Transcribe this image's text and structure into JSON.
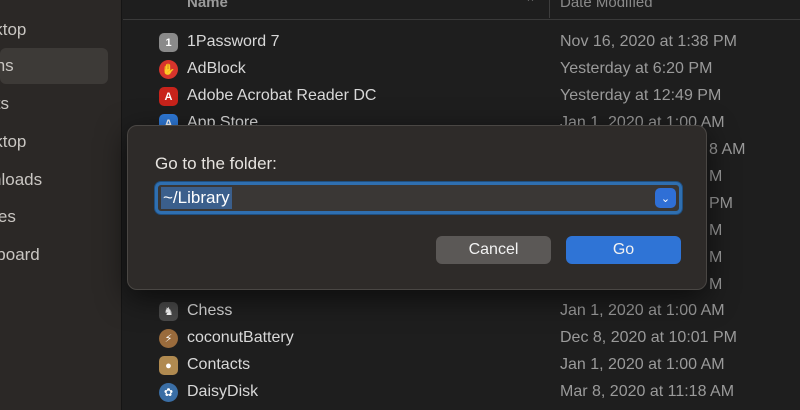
{
  "sidebar": {
    "items": [
      {
        "label": "Desktop",
        "selected": false
      },
      {
        "label": "Applications",
        "selected": true
      },
      {
        "label": "Documents",
        "selected": false
      },
      {
        "label": "Desktop",
        "selected": false
      },
      {
        "label": "Downloads",
        "selected": false
      },
      {
        "label": "Movies",
        "selected": false
      },
      {
        "label": "Clipboard",
        "selected": false
      }
    ]
  },
  "list": {
    "columns": {
      "name": "Name",
      "date": "Date Modified"
    },
    "rows": [
      {
        "name": "1Password 7",
        "date": "Nov 16, 2020 at 1:38 PM",
        "icon": "1password-icon",
        "color": "#8a8a8a"
      },
      {
        "name": "AdBlock",
        "date": "Yesterday at 6:20 PM",
        "icon": "adblock-icon",
        "color": "#d8342c"
      },
      {
        "name": "Adobe Acrobat Reader DC",
        "date": "Yesterday at 12:49 PM",
        "icon": "acrobat-icon",
        "color": "#c8231b"
      },
      {
        "name": "App Store",
        "date": "Jan 1, 2020 at 1:00 AM",
        "icon": "app-store-icon",
        "color": "#2f7ad9"
      },
      {
        "name": "Chess",
        "date": "Jan 1, 2020 at 1:00 AM",
        "icon": "chess-icon",
        "color": "#4a4a4a"
      },
      {
        "name": "coconutBattery",
        "date": "Dec 8, 2020 at 10:01 PM",
        "icon": "battery-icon",
        "color": "#9a6b3c"
      },
      {
        "name": "Contacts",
        "date": "Jan 1, 2020 at 1:00 AM",
        "icon": "contacts-icon",
        "color": "#b08a50"
      },
      {
        "name": "DaisyDisk",
        "date": "Mar 8, 2020 at 11:18 AM",
        "icon": "daisydisk-icon",
        "color": "#3a6ea5"
      }
    ],
    "fragments": [
      "8 AM",
      "M",
      "PM",
      "M",
      "M",
      "M"
    ]
  },
  "dialog": {
    "title": "Go to the folder:",
    "path_value": "~/Library",
    "cancel_label": "Cancel",
    "go_label": "Go"
  },
  "colors": {
    "accent": "#2f74d6",
    "selection": "#3b5f8c"
  }
}
